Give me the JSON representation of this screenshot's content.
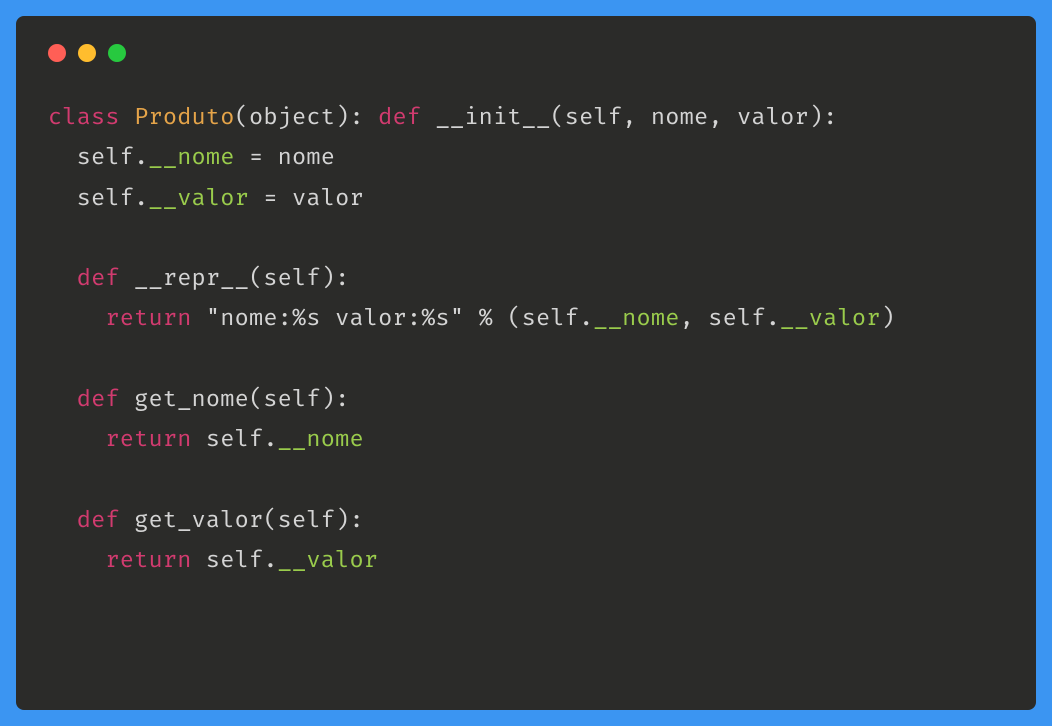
{
  "windowControls": {
    "red": "close",
    "yellow": "minimize",
    "green": "maximize"
  },
  "code": {
    "line1": {
      "kw_class": "class",
      "classname": "Produto",
      "after_class": "(object): ",
      "kw_def1": "def",
      "init_pre": " __",
      "init_name": "init",
      "init_post": "__(self, nome, valor):"
    },
    "line2": {
      "indent": "  self.",
      "attr": "__nome",
      "rest": " = nome"
    },
    "line3": {
      "indent": "  self.",
      "attr": "__valor",
      "rest": " = valor"
    },
    "line5": {
      "indent": "  ",
      "kw_def": "def",
      "pre": " __",
      "name": "repr",
      "post": "__(self):"
    },
    "line6": {
      "indent": "    ",
      "kw_return": "return",
      "str": " \"nome:%s valor:%s\"",
      "mid1": " % (self.",
      "attr1": "__nome",
      "mid2": ", self.",
      "attr2": "__valor",
      "end": ")"
    },
    "line8": {
      "indent": "  ",
      "kw_def": "def",
      "rest": " get_nome(self):"
    },
    "line9": {
      "indent": "    ",
      "kw_return": "return",
      "mid": " self.",
      "attr": "__nome"
    },
    "line11": {
      "indent": "  ",
      "kw_def": "def",
      "rest": " get_valor(self):"
    },
    "line12": {
      "indent": "    ",
      "kw_return": "return",
      "mid": " self.",
      "attr": "__valor"
    }
  }
}
